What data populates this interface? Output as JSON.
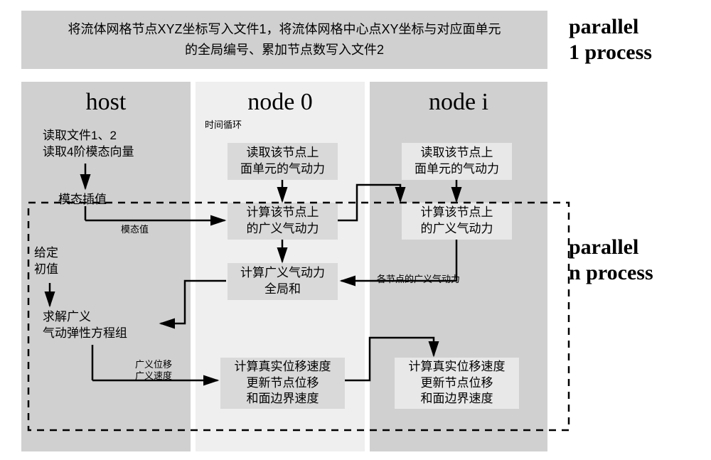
{
  "top": {
    "text": "将流体网格节点XYZ坐标写入文件1，将流体网格中心点XY坐标与对应面单元的全局编号、累加节点数写入文件2"
  },
  "cols": {
    "host": {
      "title": "host"
    },
    "node0": {
      "title": "node 0"
    },
    "nodei": {
      "title": "node i"
    }
  },
  "host": {
    "read": "读取文件1、2\n读取4阶模态向量",
    "interp": "模态插值",
    "init": "给定\n初值",
    "solve": "求解广义\n气动弹性方程组"
  },
  "node0": {
    "b1": "读取该节点上\n面单元的气动力",
    "b2": "计算该节点上\n的广义气动力",
    "b3": "计算广义气动力\n全局和",
    "b4": "计算真实位移速度\n更新节点位移\n和面边界速度"
  },
  "nodei": {
    "b1": "读取该节点上\n面单元的气动力",
    "b2": "计算该节点上\n的广义气动力",
    "b4": "计算真实位移速度\n更新节点位移\n和面边界速度"
  },
  "labels": {
    "timeloop": "时间循环",
    "modalval": "模态值",
    "gen_aero": "各节点的广义气动力",
    "gen_disp_vel": "广义位移\n广义速度"
  },
  "side": {
    "p1": "parallel\n1 process",
    "pn": "parallel\nn process"
  }
}
